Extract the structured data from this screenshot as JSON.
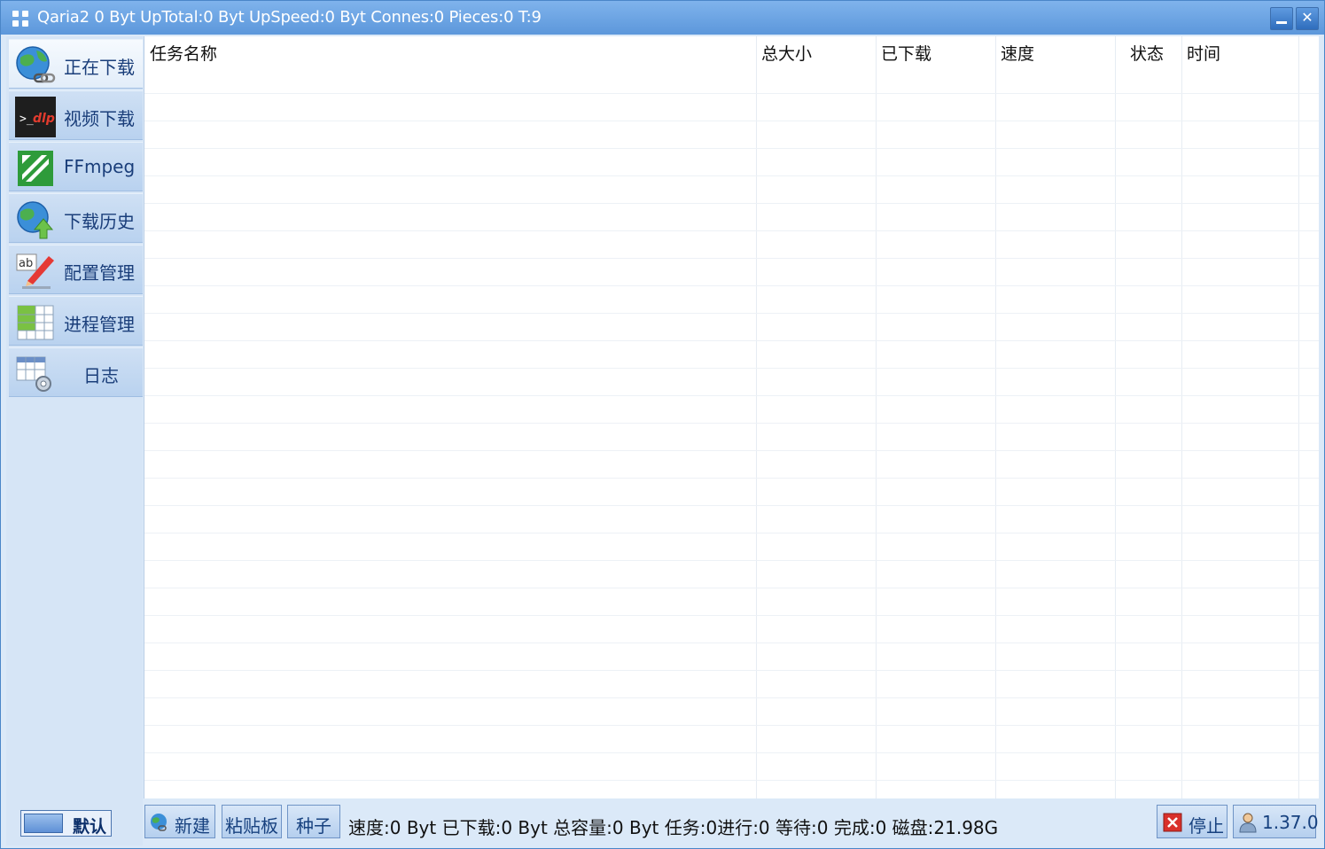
{
  "window": {
    "title": "Qaria2 0 Byt UpTotal:0 Byt UpSpeed:0 Byt Connes:0 Pieces:0 T:9"
  },
  "sidebar": {
    "items": [
      {
        "label": "正在下载",
        "icon": "globe-link-icon",
        "active": true
      },
      {
        "label": "视频下载",
        "icon": "ytdlp-terminal-icon",
        "active": false
      },
      {
        "label": "FFmpeg",
        "icon": "ffmpeg-icon",
        "active": false
      },
      {
        "label": "下载历史",
        "icon": "globe-upload-icon",
        "active": false
      },
      {
        "label": "配置管理",
        "icon": "ab-pencil-icon",
        "active": false
      },
      {
        "label": "进程管理",
        "icon": "grid-sheet-icon",
        "active": false
      },
      {
        "label": "日志",
        "icon": "table-gear-icon",
        "active": false
      }
    ],
    "default_label": "默认"
  },
  "table": {
    "columns": [
      "任务名称",
      "总大小",
      "已下载",
      "速度",
      "状态",
      "时间"
    ],
    "rows": []
  },
  "bottombar": {
    "new_label": "新建",
    "clipboard_label": "粘贴板",
    "torrent_label": "种子",
    "status": "速度:0 Byt 已下载:0 Byt 总容量:0 Byt 任务:0进行:0 等待:0 完成:0 磁盘:21.98G",
    "stop_label": "停止",
    "version_label": "1.37.0"
  },
  "colors": {
    "titlebar": "#5c97db",
    "sidebar": "#d6e5f6",
    "accent_text": "#1a3e7a"
  }
}
